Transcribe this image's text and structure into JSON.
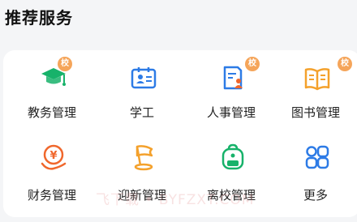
{
  "section": {
    "title": "推荐服务"
  },
  "services": [
    {
      "label": "教务管理",
      "icon": "graduation-cap-icon",
      "badge": "校",
      "color": "#17b26a"
    },
    {
      "label": "学工",
      "icon": "student-id-card-icon",
      "badge": "",
      "color": "#2d7be6"
    },
    {
      "label": "人事管理",
      "icon": "personnel-document-icon",
      "badge": "校",
      "color": "#2d7be6"
    },
    {
      "label": "图书管理",
      "icon": "open-book-icon",
      "badge": "校",
      "color": "#f4a12c"
    },
    {
      "label": "财务管理",
      "icon": "finance-coin-icon",
      "badge": "",
      "color": "#f0672c"
    },
    {
      "label": "迎新管理",
      "icon": "welcome-flag-icon",
      "badge": "",
      "color": "#f4a12c"
    },
    {
      "label": "离校管理",
      "icon": "backpack-icon",
      "badge": "",
      "color": "#17b26a"
    },
    {
      "label": "更多",
      "icon": "more-grid-icon",
      "badge": "",
      "color": "#2d7be6"
    }
  ],
  "watermark": "飞下载 • BYFZXT.COM"
}
